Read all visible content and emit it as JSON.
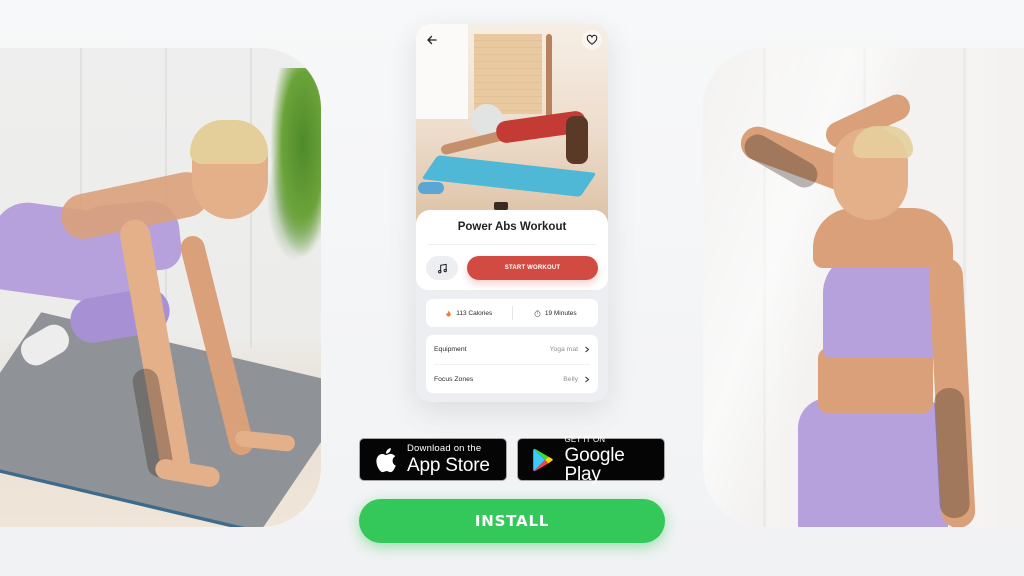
{
  "phone": {
    "back_icon": "arrow-left-icon",
    "favorite_icon": "heart-icon",
    "workout_title": "Power Abs Workout",
    "music_icon": "music-note-icon",
    "start_button_label": "START WORKOUT",
    "stats": [
      {
        "icon": "flame-icon",
        "label": "113 Calories"
      },
      {
        "icon": "stopwatch-icon",
        "label": "19 Minutes"
      }
    ],
    "details": [
      {
        "label": "Equipment",
        "value": "Yoga mat"
      },
      {
        "label": "Focus Zones",
        "value": "Belly"
      }
    ]
  },
  "badges": {
    "app_store": {
      "small": "Download on the",
      "big": "App Store",
      "icon": "apple-icon"
    },
    "google_play": {
      "small": "GET IT ON",
      "big": "Google Play",
      "icon": "google-play-icon"
    }
  },
  "install": {
    "label": "INSTALL"
  },
  "colors": {
    "accent_red": "#d24b43",
    "install_green": "#34c759",
    "outfit_lavender": "#b7a1dc",
    "background": "#f1f2f4"
  },
  "photos": {
    "left": "woman-workout-on-gray-mat",
    "right": "woman-smiling-in-lavender-sportswear"
  }
}
